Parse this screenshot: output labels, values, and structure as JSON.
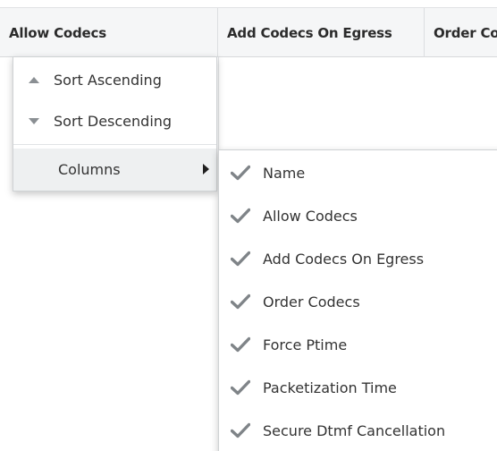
{
  "table": {
    "columns": [
      {
        "label": "Allow Codecs"
      },
      {
        "label": "Add Codecs On Egress"
      },
      {
        "label": "Order Co"
      }
    ]
  },
  "context_menu": {
    "items": [
      {
        "label": "Sort Ascending",
        "icon": "sort-ascending-icon"
      },
      {
        "label": "Sort Descending",
        "icon": "sort-descending-icon"
      },
      {
        "label": "Columns",
        "icon": "chevron-right-icon",
        "has_submenu": true
      }
    ]
  },
  "columns_submenu": {
    "items": [
      {
        "label": "Name",
        "checked": true
      },
      {
        "label": "Allow Codecs",
        "checked": true
      },
      {
        "label": "Add Codecs On Egress",
        "checked": true
      },
      {
        "label": "Order Codecs",
        "checked": true
      },
      {
        "label": "Force Ptime",
        "checked": true
      },
      {
        "label": "Packetization Time",
        "checked": true
      },
      {
        "label": "Secure Dtmf Cancellation",
        "checked": true
      }
    ]
  },
  "colors": {
    "header_bg": "#f5f6f7",
    "check": "#7f8488",
    "hover_bg": "#eef0f1",
    "text": "#333333"
  }
}
